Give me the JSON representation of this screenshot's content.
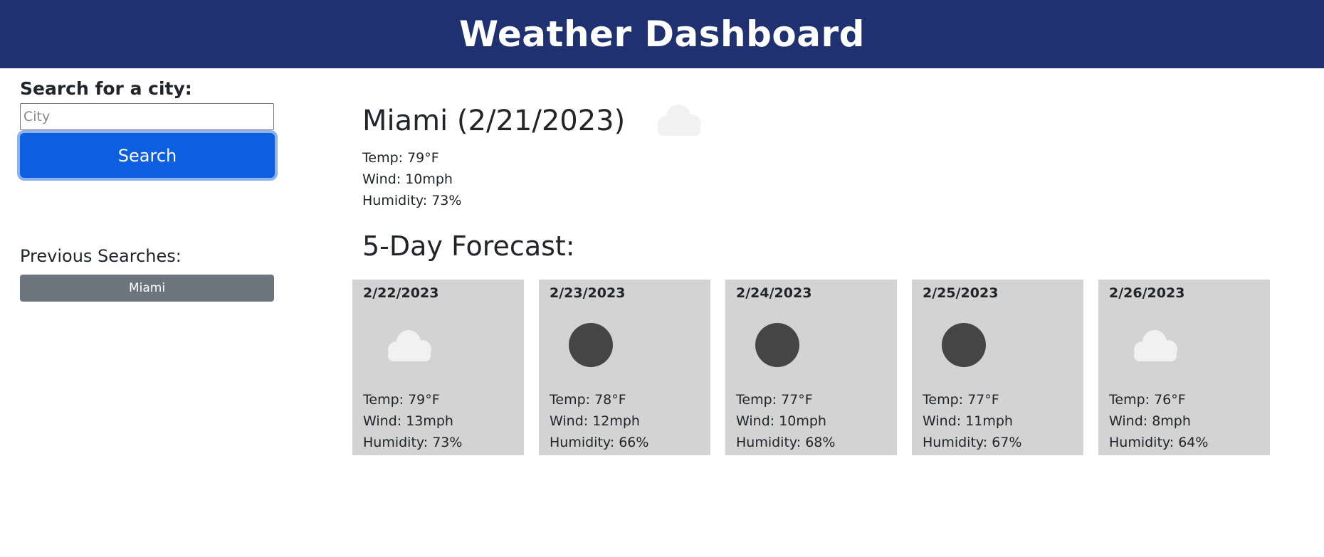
{
  "header": {
    "title": "Weather Dashboard"
  },
  "sidebar": {
    "search_label": "Search for a city:",
    "input_placeholder": "City",
    "input_value": "",
    "search_button_label": "Search",
    "previous_title": "Previous Searches:",
    "history": [
      "Miami"
    ]
  },
  "current": {
    "title": "Miami (2/21/2023)",
    "icon": "cloud-icon",
    "temp": "Temp: 79°F",
    "wind": "Wind: 10mph",
    "humidity": "Humidity: 73%"
  },
  "forecast": {
    "title": "5-Day Forecast:",
    "days": [
      {
        "date": "2/22/2023",
        "icon": "cloud-icon",
        "temp": "Temp: 79°F",
        "wind": "Wind: 13mph",
        "humidity": "Humidity: 73%"
      },
      {
        "date": "2/23/2023",
        "icon": "moon-icon",
        "temp": "Temp: 78°F",
        "wind": "Wind: 12mph",
        "humidity": "Humidity: 66%"
      },
      {
        "date": "2/24/2023",
        "icon": "moon-icon",
        "temp": "Temp: 77°F",
        "wind": "Wind: 10mph",
        "humidity": "Humidity: 68%"
      },
      {
        "date": "2/25/2023",
        "icon": "moon-icon",
        "temp": "Temp: 77°F",
        "wind": "Wind: 11mph",
        "humidity": "Humidity: 67%"
      },
      {
        "date": "2/26/2023",
        "icon": "cloud-icon",
        "temp": "Temp: 76°F",
        "wind": "Wind: 8mph",
        "humidity": "Humidity: 64%"
      }
    ]
  },
  "colors": {
    "header_bg": "#1f3170",
    "search_button": "#0d5fe0",
    "history_button": "#6c757d",
    "card_bg": "#d3d3d3",
    "cloud": "#f1f1f1",
    "moon": "#454545"
  }
}
